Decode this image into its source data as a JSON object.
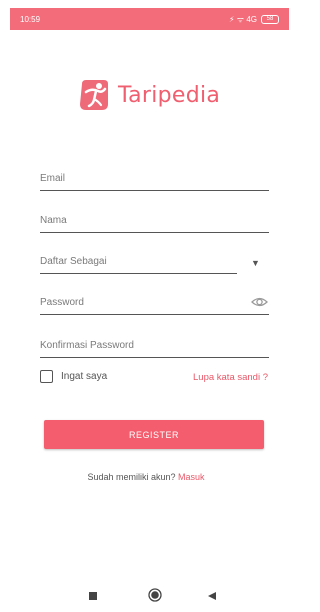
{
  "status_bar": {
    "time": "10:59",
    "icons": "⚡ ᯤ 4G",
    "battery": "58",
    "color": "#f36c7a"
  },
  "logo": {
    "icon": "taripedia-dancer-logo",
    "text": "Taripedia",
    "color": "#ef5f6f"
  },
  "form": {
    "email_label": "Email",
    "name_label": "Nama",
    "role_label": "Daftar Sebagai",
    "password_label": "Password",
    "confirm_password_label": "Konfirmasi Password",
    "remember_label": "Ingat saya",
    "remember_checked": false,
    "forgot_label": "Lupa kata sandi ?",
    "register_label": "REGISTER",
    "register_color": "#f45d6d"
  },
  "footer": {
    "question": "Sudah memiliki akun?",
    "login_link": "Masuk"
  },
  "nav": {
    "recent_icon": "square-icon",
    "home_icon": "circle-icon",
    "back_icon": "triangle-back-icon"
  }
}
